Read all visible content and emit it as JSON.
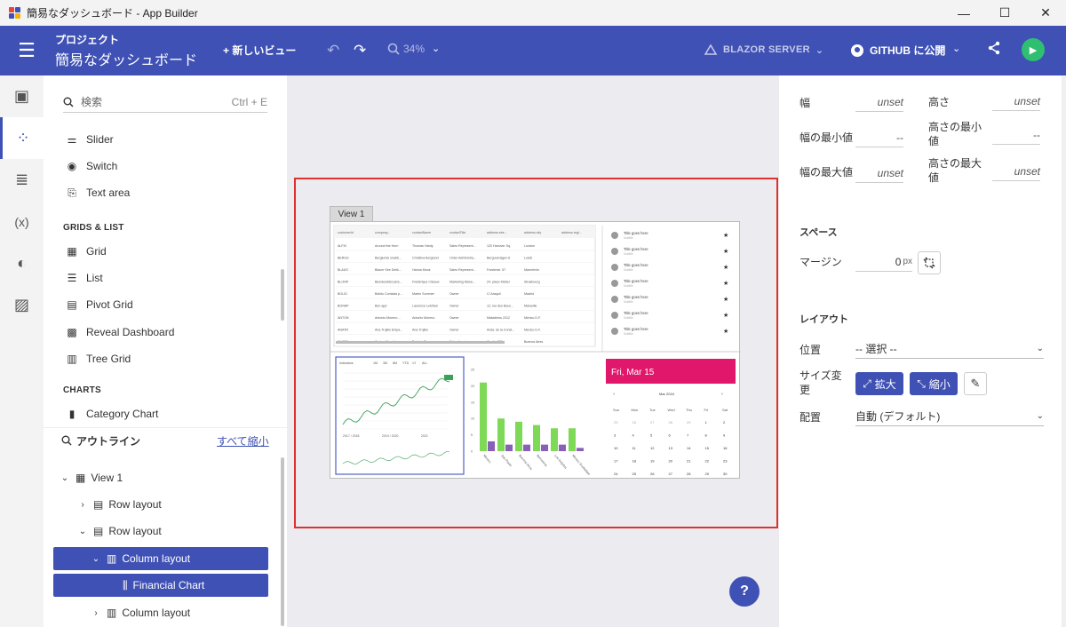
{
  "window": {
    "title": "簡易なダッシュボード - App Builder",
    "minimize": "—",
    "maximize": "☐",
    "close": "✕"
  },
  "toolbar": {
    "menu_icon": "☰",
    "project_label": "プロジェクト",
    "project_name": "簡易なダッシュボード",
    "new_view": "+ 新しいビュー",
    "undo_icon": "↶",
    "redo_icon": "↷",
    "zoom": "34%",
    "zoom_caret": "⌄",
    "platform": "BLAZOR SERVER",
    "platform_caret": "⌄",
    "github": "GITHUB に公開",
    "github_caret": "⌄",
    "share_icon": "⋖",
    "run_icon": "▶"
  },
  "rail": {
    "items": [
      {
        "icon": "▣",
        "name": "views"
      },
      {
        "icon": "⁘",
        "name": "components"
      },
      {
        "icon": "≣",
        "name": "data"
      },
      {
        "icon": "(x)",
        "name": "variables"
      },
      {
        "icon": "◐",
        "name": "theme"
      },
      {
        "icon": "▨",
        "name": "assets"
      }
    ]
  },
  "components": {
    "search_placeholder": "検索",
    "search_hint": "Ctrl + E",
    "items_top": [
      {
        "label": "Slider",
        "icon": "⚌"
      },
      {
        "label": "Switch",
        "icon": "◉"
      },
      {
        "label": "Text area",
        "icon": "⎘"
      }
    ],
    "grids_label": "GRIDS & LIST",
    "grids": [
      {
        "label": "Grid",
        "icon": "▦"
      },
      {
        "label": "List",
        "icon": "☰"
      },
      {
        "label": "Pivot Grid",
        "icon": "▤"
      },
      {
        "label": "Reveal Dashboard",
        "icon": "▩"
      },
      {
        "label": "Tree Grid",
        "icon": "▥"
      }
    ],
    "charts_label": "CHARTS",
    "charts": [
      {
        "label": "Category Chart",
        "icon": "▮"
      }
    ]
  },
  "outline": {
    "title": "アウトライン",
    "collapse_all": "すべて縮小",
    "rows": [
      {
        "label": "View 1",
        "chev": "⌄"
      },
      {
        "label": "Row layout",
        "chev": "›"
      },
      {
        "label": "Row layout",
        "chev": "⌄"
      },
      {
        "label": "Column layout",
        "chev": "⌄"
      },
      {
        "label": "Financial Chart",
        "chev": ""
      },
      {
        "label": "Column layout",
        "chev": "›"
      }
    ]
  },
  "canvas": {
    "view_tab": "View 1",
    "grid_headers": [
      "customerId",
      "company...",
      "contactName",
      "contactTitle",
      "address.stre...",
      "address.city",
      "address.regi..."
    ],
    "grid_rows": [
      [
        "ALFKI",
        "Around the Horn",
        "Thomas Hardy",
        "Sales Represent...",
        "120 Hanover Sq.",
        "London"
      ],
      [
        "BERGS",
        "Berglunds snabb...",
        "Christina Berglund",
        "Order Administra...",
        "Berguvsvägen 8",
        "Luleå"
      ],
      [
        "BLAUS",
        "Blauer See Delik...",
        "Hanna Moos",
        "Sales Represent...",
        "Forsterstr. 57",
        "Mannheim"
      ],
      [
        "BLONP",
        "Blondesddsl père...",
        "Frédérique Citeaux",
        "Marketing Mana...",
        "24, place Kléber",
        "Strasbourg"
      ],
      [
        "BOLID",
        "Bólido Comidas p...",
        "Martín Sommer",
        "Owner",
        "C/ Araquil",
        "Madrid"
      ],
      [
        "BONAP",
        "Bon app'",
        "Laurence Lebihan",
        "Owner",
        "12, rue des Bouc...",
        "Marseille"
      ],
      [
        "ANTON",
        "Antonio Moreno ...",
        "Antonio Moreno",
        "Owner",
        "Mataderos 2312",
        "México D.F."
      ],
      [
        "ANATR",
        "Ana Trujillo Empa...",
        "Ana Trujillo",
        "Owner",
        "Avda. de la Const...",
        "México D.F."
      ],
      [
        "CACTU",
        "Cactus Comidas ...",
        "Patricio Simpson",
        "Sales Agent",
        "Cerrito 333",
        "Buenos Aires"
      ]
    ],
    "list_title": "Title goes here",
    "list_sub": "Subtitle",
    "list_count": 7,
    "fin_toolbar": [
      "Indicators",
      "1M",
      "3M",
      "6M",
      "YTD",
      "1Y",
      "ALL"
    ],
    "fin_dates": [
      "2017 / 2018",
      "2019 / 2020",
      "2021"
    ],
    "bar_chart": {
      "categories": [
        "Mexico",
        "Sao Paulo",
        "Buenos Aires",
        "Barcelona",
        "Los Angeles",
        "Mexico Scottsdale"
      ],
      "green": [
        21,
        10,
        9,
        8,
        7,
        7
      ],
      "purple": [
        3,
        2,
        2,
        2,
        2,
        1
      ],
      "yticks": [
        "25",
        "20",
        "15",
        "10",
        "5",
        "0"
      ],
      "ymax": 25,
      "green_color": "#7ed957",
      "purple_color": "#8a5fb8"
    },
    "calendar": {
      "header_date": "Fri, Mar 15",
      "month": "Mar 2024",
      "header_color": "#e0176a",
      "weekdays": [
        "Sun",
        "Mon",
        "Tue",
        "Wed",
        "Thu",
        "Fri",
        "Sat"
      ],
      "weeks": [
        [
          "25",
          "26",
          "27",
          "28",
          "29",
          "1",
          "2"
        ],
        [
          "3",
          "4",
          "5",
          "6",
          "7",
          "8",
          "9"
        ],
        [
          "10",
          "11",
          "12",
          "13",
          "14",
          "15",
          "16"
        ],
        [
          "17",
          "18",
          "19",
          "20",
          "21",
          "22",
          "23"
        ],
        [
          "24",
          "25",
          "26",
          "27",
          "28",
          "29",
          "30"
        ],
        [
          "31",
          "1",
          "2",
          "3",
          "4",
          "5",
          "6"
        ]
      ]
    },
    "help": "?"
  },
  "props": {
    "width_label": "幅",
    "width_val": "unset",
    "height_label": "高さ",
    "height_val": "unset",
    "min_width_label": "幅の最小値",
    "min_width_val": "--",
    "min_height_label": "高さの最小値",
    "min_height_val": "--",
    "max_width_label": "幅の最大値",
    "max_width_val": "unset",
    "max_height_label": "高さの最大値",
    "max_height_val": "unset",
    "space_section": "スペース",
    "margin_label": "マージン",
    "margin_val": "0",
    "margin_unit": "px",
    "layout_section": "レイアウト",
    "position_label": "位置",
    "position_val": "-- 選択 --",
    "resize_label": "サイズ変更",
    "grow_btn": "拡大",
    "shrink_btn": "縮小",
    "align_label": "配置",
    "align_val": "自動 (デフォルト)"
  },
  "colors": {
    "brand": "#3f51b5",
    "selection_outline": "#e03030",
    "run_green": "#2fbf71"
  }
}
